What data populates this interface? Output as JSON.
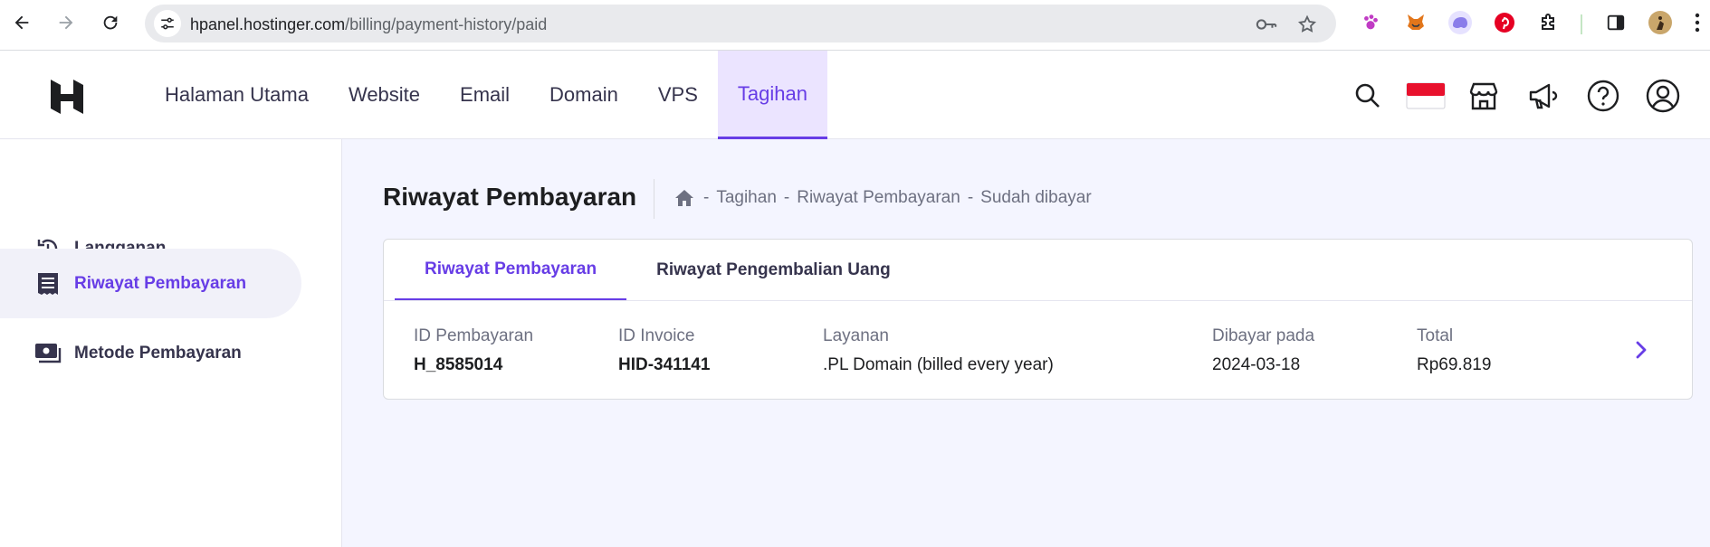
{
  "browser": {
    "url_host": "hpanel.hostinger.com",
    "url_path": "/billing/payment-history/paid"
  },
  "nav": {
    "items": [
      {
        "label": "Halaman Utama",
        "active": false
      },
      {
        "label": "Website",
        "active": false
      },
      {
        "label": "Email",
        "active": false
      },
      {
        "label": "Domain",
        "active": false
      },
      {
        "label": "VPS",
        "active": false
      },
      {
        "label": "Tagihan",
        "active": true
      }
    ]
  },
  "sidebar": {
    "items": [
      {
        "label": "Langganan",
        "icon": "history-icon"
      },
      {
        "label": "Riwayat Pembayaran",
        "icon": "receipt-icon"
      },
      {
        "label": "Metode Pembayaran",
        "icon": "payment-method-icon"
      }
    ]
  },
  "page": {
    "title": "Riwayat Pembayaran",
    "breadcrumb": [
      "Tagihan",
      "Riwayat Pembayaran",
      "Sudah dibayar"
    ],
    "breadcrumb_sep": "-"
  },
  "tabs": [
    {
      "label": "Riwayat Pembayaran",
      "active": true
    },
    {
      "label": "Riwayat Pengembalian Uang",
      "active": false
    }
  ],
  "table": {
    "headers": {
      "payment_id": "ID Pembayaran",
      "invoice": "ID Invoice",
      "service": "Layanan",
      "paid_at": "Dibayar pada",
      "total": "Total"
    },
    "rows": [
      {
        "payment_id": "H_8585014",
        "invoice": "HID-341141",
        "service": ".PL Domain (billed every year)",
        "paid_at": "2024-03-18",
        "total": "Rp69.819"
      }
    ]
  },
  "colors": {
    "accent": "#673de6",
    "page_bg": "#f4f5ff",
    "text_dark": "#1d1e20",
    "text_muted": "#6d7081",
    "flag_red": "#e8112d"
  }
}
